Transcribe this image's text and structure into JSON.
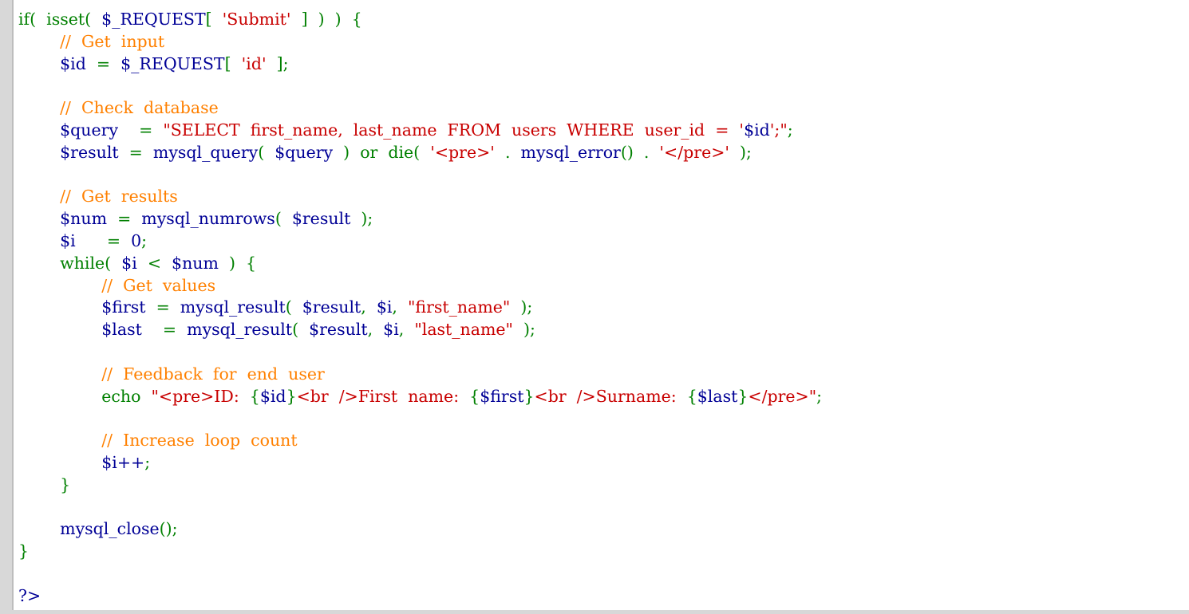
{
  "colors": {
    "keyword": "#008000",
    "variable": "#000096",
    "string": "#c80000",
    "comment": "#ff8000"
  },
  "lines": [
    [
      [
        "kw",
        "if(  isset(  "
      ],
      [
        "var",
        "$_REQUEST"
      ],
      [
        "kw",
        "[  "
      ],
      [
        "str",
        "'Submit'"
      ],
      [
        "kw",
        "  ]  )  )  {"
      ]
    ],
    [
      [
        "sp",
        "        "
      ],
      [
        "cm",
        "//  Get  input"
      ]
    ],
    [
      [
        "sp",
        "        "
      ],
      [
        "var",
        "$id"
      ],
      [
        "kw",
        "  =  "
      ],
      [
        "var",
        "$_REQUEST"
      ],
      [
        "kw",
        "[  "
      ],
      [
        "str",
        "'id'"
      ],
      [
        "kw",
        "  ];"
      ]
    ],
    [],
    [
      [
        "sp",
        "        "
      ],
      [
        "cm",
        "//  Check  database"
      ]
    ],
    [
      [
        "sp",
        "        "
      ],
      [
        "var",
        "$query"
      ],
      [
        "kw",
        "    =  "
      ],
      [
        "str",
        "\"SELECT  first_name,  last_name  FROM  users  WHERE  user_id  =  '"
      ],
      [
        "var",
        "$id"
      ],
      [
        "str",
        "';\""
      ],
      [
        "kw",
        ";"
      ]
    ],
    [
      [
        "sp",
        "        "
      ],
      [
        "var",
        "$result"
      ],
      [
        "kw",
        "  =  "
      ],
      [
        "var",
        "mysql_query"
      ],
      [
        "kw",
        "(  "
      ],
      [
        "var",
        "$query"
      ],
      [
        "kw",
        "  )  or  die(  "
      ],
      [
        "str",
        "'<pre>'"
      ],
      [
        "kw",
        "  .  "
      ],
      [
        "var",
        "mysql_error"
      ],
      [
        "kw",
        "()  .  "
      ],
      [
        "str",
        "'</pre>'"
      ],
      [
        "kw",
        "  );"
      ]
    ],
    [],
    [
      [
        "sp",
        "        "
      ],
      [
        "cm",
        "//  Get  results"
      ]
    ],
    [
      [
        "sp",
        "        "
      ],
      [
        "var",
        "$num"
      ],
      [
        "kw",
        "  =  "
      ],
      [
        "var",
        "mysql_numrows"
      ],
      [
        "kw",
        "(  "
      ],
      [
        "var",
        "$result"
      ],
      [
        "kw",
        "  );"
      ]
    ],
    [
      [
        "sp",
        "        "
      ],
      [
        "var",
        "$i"
      ],
      [
        "kw",
        "      =  "
      ],
      [
        "var",
        "0"
      ],
      [
        "kw",
        ";"
      ]
    ],
    [
      [
        "sp",
        "        "
      ],
      [
        "kw",
        "while(  "
      ],
      [
        "var",
        "$i"
      ],
      [
        "kw",
        "  <  "
      ],
      [
        "var",
        "$num"
      ],
      [
        "kw",
        "  )  {"
      ]
    ],
    [
      [
        "sp",
        "                "
      ],
      [
        "cm",
        "//  Get  values"
      ]
    ],
    [
      [
        "sp",
        "                "
      ],
      [
        "var",
        "$first"
      ],
      [
        "kw",
        "  =  "
      ],
      [
        "var",
        "mysql_result"
      ],
      [
        "kw",
        "(  "
      ],
      [
        "var",
        "$result"
      ],
      [
        "kw",
        ",  "
      ],
      [
        "var",
        "$i"
      ],
      [
        "kw",
        ",  "
      ],
      [
        "str",
        "\"first_name\""
      ],
      [
        "kw",
        "  );"
      ]
    ],
    [
      [
        "sp",
        "                "
      ],
      [
        "var",
        "$last"
      ],
      [
        "kw",
        "    =  "
      ],
      [
        "var",
        "mysql_result"
      ],
      [
        "kw",
        "(  "
      ],
      [
        "var",
        "$result"
      ],
      [
        "kw",
        ",  "
      ],
      [
        "var",
        "$i"
      ],
      [
        "kw",
        ",  "
      ],
      [
        "str",
        "\"last_name\""
      ],
      [
        "kw",
        "  );"
      ]
    ],
    [],
    [
      [
        "sp",
        "                "
      ],
      [
        "cm",
        "//  Feedback  for  end  user"
      ]
    ],
    [
      [
        "sp",
        "                "
      ],
      [
        "kw",
        "echo  "
      ],
      [
        "str",
        "\"<pre>ID:  "
      ],
      [
        "kw",
        "{"
      ],
      [
        "var",
        "$id"
      ],
      [
        "kw",
        "}"
      ],
      [
        "str",
        "<br  />First  name:  "
      ],
      [
        "kw",
        "{"
      ],
      [
        "var",
        "$first"
      ],
      [
        "kw",
        "}"
      ],
      [
        "str",
        "<br  />Surname:  "
      ],
      [
        "kw",
        "{"
      ],
      [
        "var",
        "$last"
      ],
      [
        "kw",
        "}"
      ],
      [
        "str",
        "</pre>\""
      ],
      [
        "kw",
        ";"
      ]
    ],
    [],
    [
      [
        "sp",
        "                "
      ],
      [
        "cm",
        "//  Increase  loop  count"
      ]
    ],
    [
      [
        "sp",
        "                "
      ],
      [
        "var",
        "$i++"
      ],
      [
        "kw",
        ";"
      ]
    ],
    [
      [
        "sp",
        "        "
      ],
      [
        "kw",
        "}"
      ]
    ],
    [],
    [
      [
        "sp",
        "        "
      ],
      [
        "var",
        "mysql_close"
      ],
      [
        "kw",
        "();"
      ]
    ],
    [
      [
        "kw",
        "}"
      ]
    ],
    [],
    [
      [
        "var",
        "?>"
      ]
    ]
  ]
}
